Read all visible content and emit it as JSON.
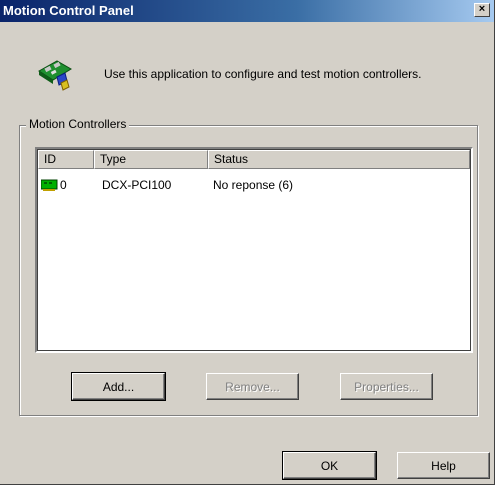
{
  "window": {
    "title": "Motion Control Panel",
    "close_glyph": "×"
  },
  "header": {
    "icon": "controller-board-icon",
    "description": "Use this application to configure and test motion controllers."
  },
  "group": {
    "label": "Motion Controllers"
  },
  "list": {
    "columns": [
      "ID",
      "Type",
      "Status"
    ],
    "rows": [
      {
        "id": "0",
        "type": "DCX-PCI100",
        "status": "No reponse (6)",
        "icon": "board-icon"
      }
    ]
  },
  "buttons": {
    "add": "Add...",
    "remove": "Remove...",
    "properties": "Properties...",
    "ok": "OK",
    "help": "Help"
  },
  "colors": {
    "title_bar": "#0a246a",
    "face": "#d4d0c8",
    "icon_green": "#00a000"
  }
}
